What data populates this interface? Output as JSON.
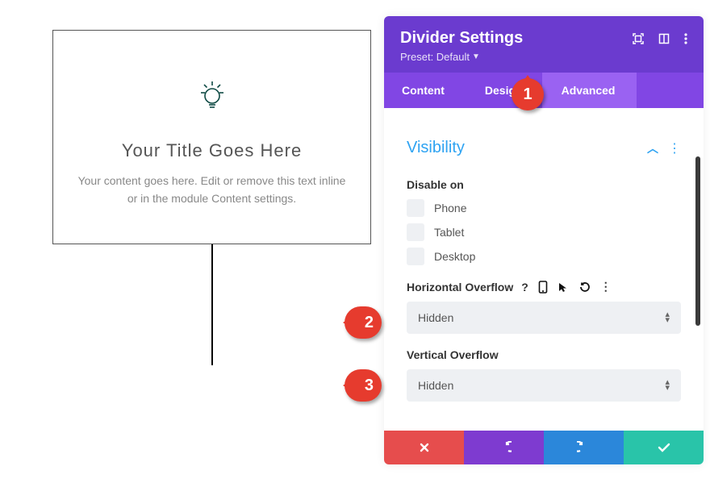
{
  "preview": {
    "title": "Your Title Goes Here",
    "text": "Your content goes here. Edit or remove this text inline or in the module Content settings."
  },
  "panel": {
    "title": "Divider Settings",
    "preset_label": "Preset: Default"
  },
  "tabs": {
    "content": "Content",
    "design": "Design",
    "advanced": "Advanced"
  },
  "visibility": {
    "title": "Visibility",
    "disable_on_label": "Disable on",
    "options": {
      "phone": "Phone",
      "tablet": "Tablet",
      "desktop": "Desktop"
    },
    "horizontal_overflow": {
      "label": "Horizontal Overflow",
      "value": "Hidden"
    },
    "vertical_overflow": {
      "label": "Vertical Overflow",
      "value": "Hidden"
    }
  },
  "callouts": {
    "one": "1",
    "two": "2",
    "three": "3"
  }
}
